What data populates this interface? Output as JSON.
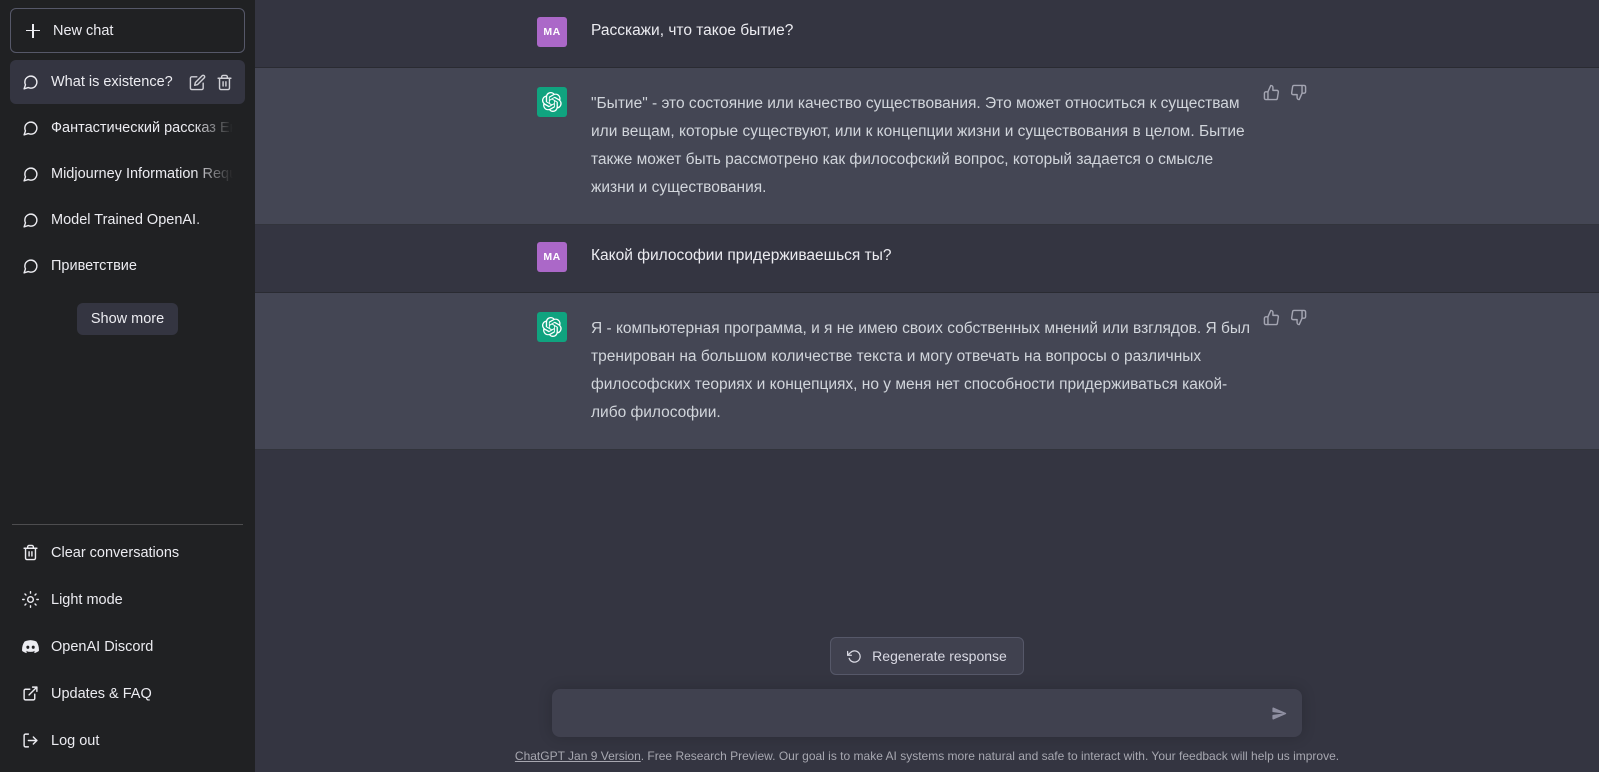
{
  "sidebar": {
    "new_chat_label": "New chat",
    "conversations": [
      {
        "title": "What is existence?",
        "active": true
      },
      {
        "title": "Фантастический рассказ Енот",
        "active": false
      },
      {
        "title": "Midjourney Information Reque",
        "active": false
      },
      {
        "title": "Model Trained OpenAI.",
        "active": false
      },
      {
        "title": "Приветствие",
        "active": false
      }
    ],
    "show_more_label": "Show more",
    "menu": [
      {
        "label": "Clear conversations",
        "icon": "trash-icon"
      },
      {
        "label": "Light mode",
        "icon": "sun-icon"
      },
      {
        "label": "OpenAI Discord",
        "icon": "discord-icon"
      },
      {
        "label": "Updates & FAQ",
        "icon": "external-link-icon"
      },
      {
        "label": "Log out",
        "icon": "logout-icon"
      }
    ]
  },
  "conversation": {
    "messages": [
      {
        "role": "user",
        "avatar_initials": "MA",
        "avatar_color": "#ab68c8",
        "text": "Расскажи, что такое бытие?"
      },
      {
        "role": "assistant",
        "avatar_color": "#10a37f",
        "text": "\"Бытие\" - это состояние или качество существования. Это может относиться к существам или вещам, которые существуют, или к концепции жизни и существования в целом. Бытие также может быть рассмотрено как философский вопрос, который задается о смысле жизни и существования."
      },
      {
        "role": "user",
        "avatar_initials": "MA",
        "avatar_color": "#ab68c8",
        "text": "Какой философии придерживаешься ты?"
      },
      {
        "role": "assistant",
        "avatar_color": "#10a37f",
        "text": "Я - компьютерная программа, и я не имею своих собственных мнений или взглядов. Я был тренирован на большом количестве текста и могу отвечать на вопросы о различных философских теориях и концепциях, но у меня нет способности придерживаться какой-либо философии."
      }
    ]
  },
  "composer": {
    "regenerate_label": "Regenerate response",
    "input_value": "",
    "input_placeholder": ""
  },
  "footer": {
    "link_text": "ChatGPT Jan 9 Version",
    "rest_text": ". Free Research Preview. Our goal is to make AI systems more natural and safe to interact with. Your feedback will help us improve."
  },
  "theme": {
    "sidebar_bg": "#202123",
    "user_row_bg": "#343541",
    "assistant_row_bg": "#444654",
    "accent_green": "#10a37f",
    "avatar_purple": "#ab68c8"
  }
}
